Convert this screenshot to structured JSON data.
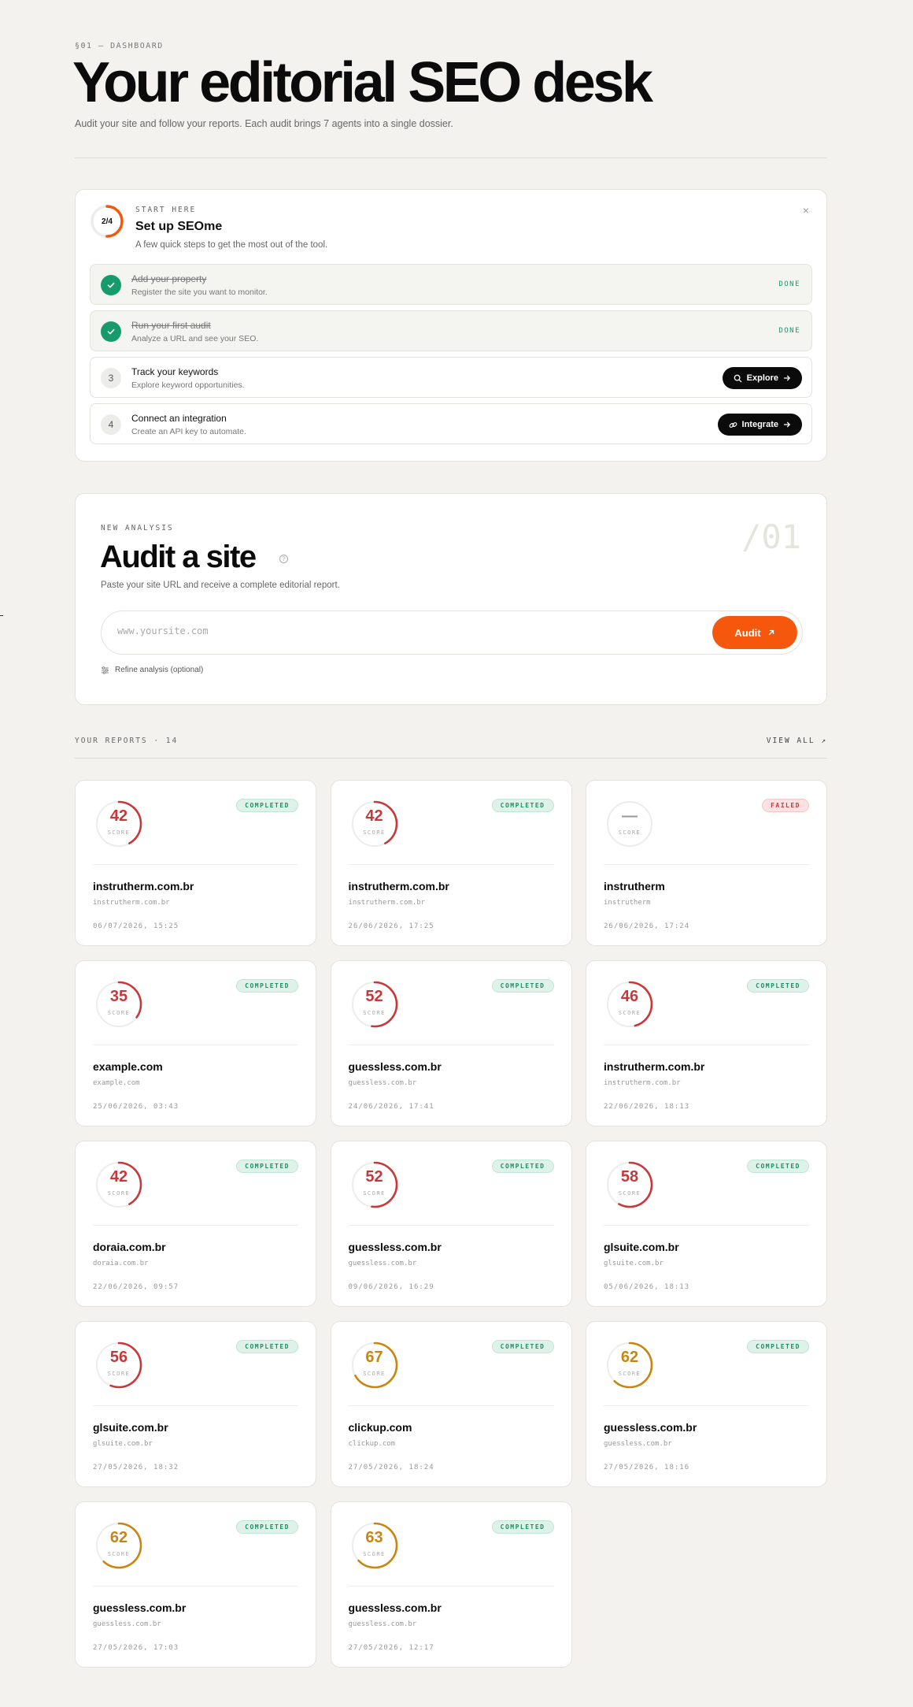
{
  "header": {
    "eyebrow": "§01 — DASHBOARD",
    "title": "Your editorial SEO desk",
    "subtitle": "Audit your site and follow your reports. Each audit brings 7 agents into a single dossier."
  },
  "setup": {
    "progress_label": "2/4",
    "progress_fraction": 0.5,
    "eyebrow": "START HERE",
    "title": "Set up SEOme",
    "subtitle": "A few quick steps to get the most out of the tool.",
    "close_icon": "×",
    "steps": [
      {
        "number": "1",
        "title": "Add your property",
        "subtitle": "Register the site you want to monitor.",
        "status": "DONE"
      },
      {
        "number": "2",
        "title": "Run your first audit",
        "subtitle": "Analyze a URL and see your SEO.",
        "status": "DONE"
      },
      {
        "number": "3",
        "title": "Track your keywords",
        "subtitle": "Explore keyword opportunities.",
        "action": "Explore"
      },
      {
        "number": "4",
        "title": "Connect an integration",
        "subtitle": "Create an API key to automate.",
        "action": "Integrate"
      }
    ]
  },
  "audit": {
    "eyebrow": "NEW ANALYSIS",
    "index": "/01",
    "title": "Audit a site",
    "subtitle": "Paste your site URL and receive a complete editorial report.",
    "placeholder": "www.yoursite.com",
    "button": "Audit",
    "refine": "Refine analysis (optional)"
  },
  "reports": {
    "heading": "YOUR REPORTS · 14",
    "view_all": "VIEW ALL ↗",
    "score_label": "SCORE",
    "colors": {
      "red": "#c8383a",
      "amber": "#c98512",
      "track": "#ececea"
    },
    "items": [
      {
        "score": "42",
        "status": "COMPLETED",
        "domain": "instrutherm.com.br",
        "url": "instrutherm.com.br",
        "date": "06/07/2026, 15:25"
      },
      {
        "score": "42",
        "status": "COMPLETED",
        "domain": "instrutherm.com.br",
        "url": "instrutherm.com.br",
        "date": "26/06/2026, 17:25"
      },
      {
        "score": "—",
        "status": "FAILED",
        "domain": "instrutherm",
        "url": "instrutherm",
        "date": "26/06/2026, 17:24"
      },
      {
        "score": "35",
        "status": "COMPLETED",
        "domain": "example.com",
        "url": "example.com",
        "date": "25/06/2026, 03:43"
      },
      {
        "score": "52",
        "status": "COMPLETED",
        "domain": "guessless.com.br",
        "url": "guessless.com.br",
        "date": "24/06/2026, 17:41"
      },
      {
        "score": "46",
        "status": "COMPLETED",
        "domain": "instrutherm.com.br",
        "url": "instrutherm.com.br",
        "date": "22/06/2026, 18:13"
      },
      {
        "score": "42",
        "status": "COMPLETED",
        "domain": "doraia.com.br",
        "url": "doraia.com.br",
        "date": "22/06/2026, 09:57"
      },
      {
        "score": "52",
        "status": "COMPLETED",
        "domain": "guessless.com.br",
        "url": "guessless.com.br",
        "date": "09/06/2026, 16:29"
      },
      {
        "score": "58",
        "status": "COMPLETED",
        "domain": "glsuite.com.br",
        "url": "glsuite.com.br",
        "date": "05/06/2026, 18:13"
      },
      {
        "score": "56",
        "status": "COMPLETED",
        "domain": "glsuite.com.br",
        "url": "glsuite.com.br",
        "date": "27/05/2026, 18:32"
      },
      {
        "score": "67",
        "status": "COMPLETED",
        "domain": "clickup.com",
        "url": "clickup.com",
        "date": "27/05/2026, 18:24"
      },
      {
        "score": "62",
        "status": "COMPLETED",
        "domain": "guessless.com.br",
        "url": "guessless.com.br",
        "date": "27/05/2026, 18:16"
      },
      {
        "score": "62",
        "status": "COMPLETED",
        "domain": "guessless.com.br",
        "url": "guessless.com.br",
        "date": "27/05/2026, 17:03"
      },
      {
        "score": "63",
        "status": "COMPLETED",
        "domain": "guessless.com.br",
        "url": "guessless.com.br",
        "date": "27/05/2026, 12:17"
      }
    ]
  }
}
